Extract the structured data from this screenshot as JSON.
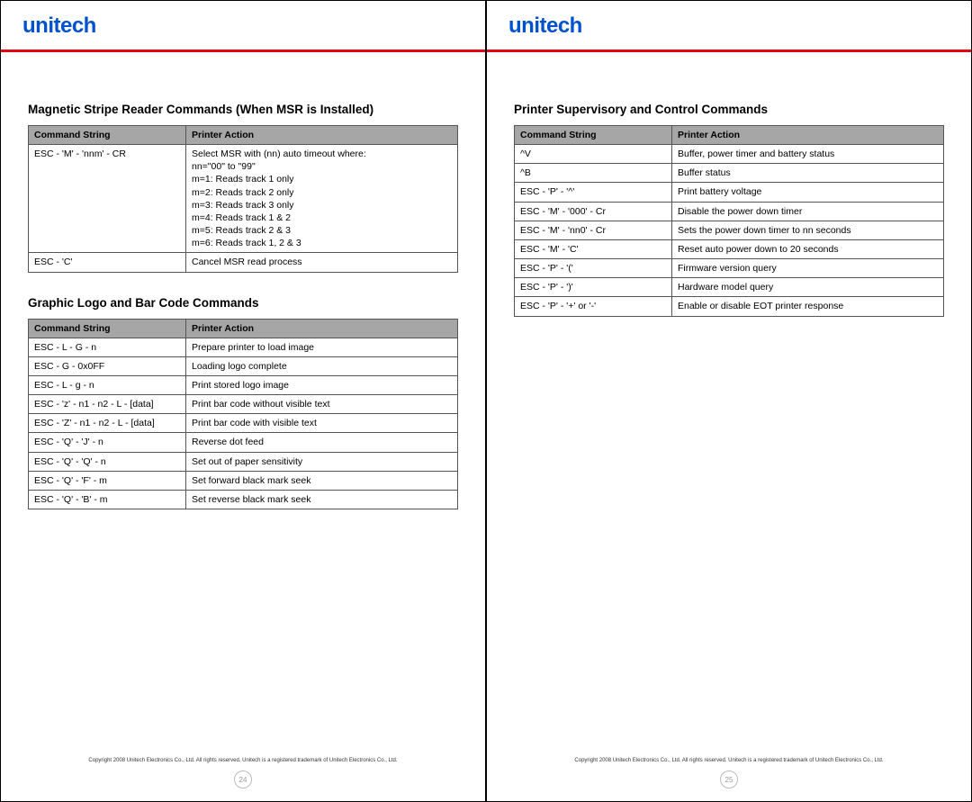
{
  "brand": "unitech",
  "copyright": "Copyright 2008 Unitech Electronics Co., Ltd. All rights reserved. Unitech is a registered trademark of Unitech Electronics Co., Ltd.",
  "left": {
    "page_number": "24",
    "section1": {
      "title": "Magnetic Stripe Reader Commands (When MSR is Installed)",
      "header_cmd": "Command String",
      "header_act": "Printer Action",
      "rows": [
        {
          "cmd": "ESC - 'M' - 'nnm' - CR",
          "act": "Select MSR  with (nn) auto timeout where:\nnn=\"00\" to \"99\"\nm=1: Reads track 1 only\nm=2: Reads track 2 only\nm=3: Reads track 3 only\nm=4: Reads track 1 & 2\nm=5: Reads track 2 & 3\nm=6: Reads track 1, 2 & 3"
        },
        {
          "cmd": "ESC - 'C'",
          "act": "Cancel MSR read process"
        }
      ]
    },
    "section2": {
      "title": "Graphic Logo and Bar Code Commands",
      "header_cmd": "Command String",
      "header_act": "Printer Action",
      "rows": [
        {
          "cmd": "ESC - L - G - n",
          "act": "Prepare printer to load image"
        },
        {
          "cmd": "ESC - G - 0x0FF",
          "act": "Loading logo complete"
        },
        {
          "cmd": "ESC - L - g - n",
          "act": "Print stored logo image"
        },
        {
          "cmd": "ESC - 'z' - n1 - n2 - L - [data]",
          "act": "Print bar code without visible text"
        },
        {
          "cmd": "ESC - 'Z' - n1 - n2 - L - [data]",
          "act": "Print bar code with visible text"
        },
        {
          "cmd": "ESC - 'Q' - 'J' - n",
          "act": "Reverse dot feed"
        },
        {
          "cmd": "ESC - 'Q' - 'Q' - n",
          "act": "Set out of paper sensitivity"
        },
        {
          "cmd": "ESC - 'Q' - 'F' - m",
          "act": "Set forward black mark seek"
        },
        {
          "cmd": "ESC - 'Q' - 'B' - m",
          "act": "Set reverse black mark seek"
        }
      ]
    }
  },
  "right": {
    "page_number": "25",
    "section1": {
      "title": "Printer Supervisory and Control Commands",
      "header_cmd": "Command String",
      "header_act": "Printer Action",
      "rows": [
        {
          "cmd": "^V",
          "act": "Buffer, power timer and battery status"
        },
        {
          "cmd": "^B",
          "act": "Buffer status"
        },
        {
          "cmd": "ESC - 'P' - '^'",
          "act": "Print battery voltage"
        },
        {
          "cmd": "ESC - 'M' - '000' - Cr",
          "act": "Disable the power down timer"
        },
        {
          "cmd": "ESC - 'M' - 'nn0' - Cr",
          "act": "Sets the power down timer to nn seconds"
        },
        {
          "cmd": "ESC - 'M' - 'C'",
          "act": "Reset auto power down to 20 seconds"
        },
        {
          "cmd": "ESC - 'P' - '('",
          "act": "Firmware version query"
        },
        {
          "cmd": "ESC - 'P' - ')'",
          "act": "Hardware model query"
        },
        {
          "cmd": "ESC - 'P' - '+' or '-'",
          "act": "Enable or disable EOT printer response"
        }
      ]
    }
  }
}
